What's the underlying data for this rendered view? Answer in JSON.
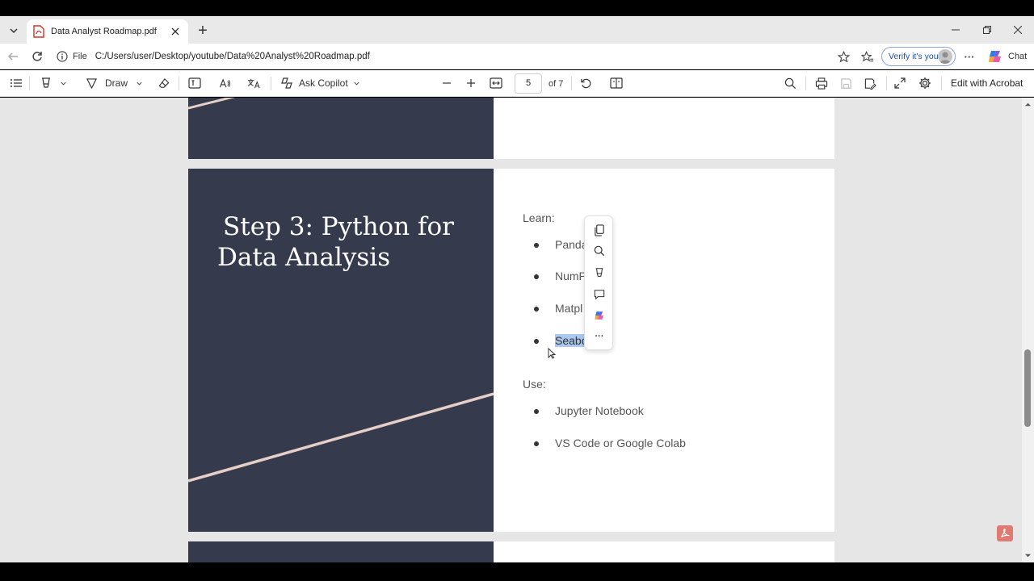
{
  "browser": {
    "tab_title": "Data Analyst Roadmap.pdf",
    "new_tab_glyph": "+",
    "file_label": "File",
    "url": "C:/Users/user/Desktop/youtube/Data%20Analyst%20Roadmap.pdf",
    "verify_label": "Verify it's you",
    "chat_label": "Chat",
    "more_glyph": "···"
  },
  "pdf_toolbar": {
    "draw_label": "Draw",
    "ask_copilot_label": "Ask Copilot",
    "page_number": "5",
    "page_total": "of 7",
    "edit_label": "Edit with Acrobat"
  },
  "document": {
    "heading_line1": "Step 3: Python for",
    "heading_line2": "Data Analysis",
    "learn_label": "Learn:",
    "learn_items": [
      "Panda",
      "NumP",
      "Matpl",
      "Seabo"
    ],
    "use_label": "Use:",
    "use_items": [
      "Jupyter Notebook",
      "VS Code or Google Colab"
    ]
  },
  "selection_menu": {
    "items": [
      "copy-icon",
      "search-icon",
      "highlight-icon",
      "comment-icon",
      "copilot-icon",
      "more-icon"
    ],
    "more_glyph": "···"
  },
  "colors": {
    "slide_dark": "#353a4d",
    "slide_stripe": "#e6cfc7",
    "selection": "#aac9ee",
    "acrobat_red": "#e07b74"
  }
}
